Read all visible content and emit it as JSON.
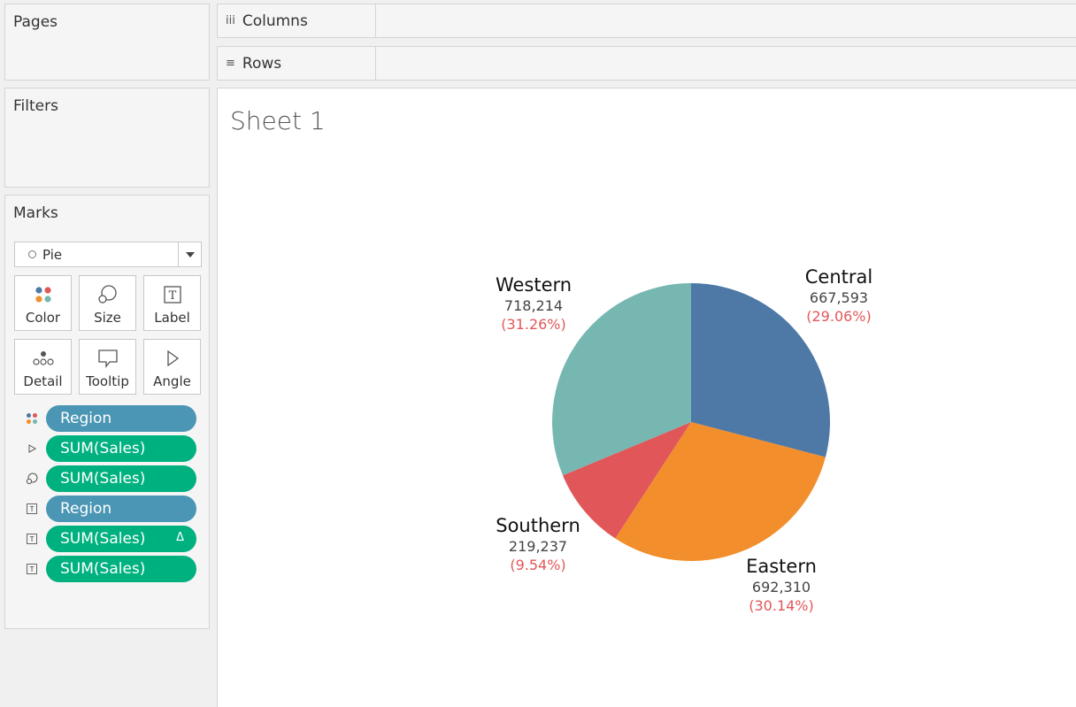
{
  "pages": {
    "title": "Pages"
  },
  "filters": {
    "title": "Filters"
  },
  "shelves": {
    "columns": {
      "icon": "iii",
      "label": "Columns"
    },
    "rows": {
      "icon": "≡",
      "label": "Rows"
    }
  },
  "marks": {
    "title": "Marks",
    "mark_type": "Pie",
    "buttons": [
      {
        "label": "Color",
        "icon": "color-dots-icon"
      },
      {
        "label": "Size",
        "icon": "size-icon"
      },
      {
        "label": "Label",
        "icon": "label-t-icon"
      },
      {
        "label": "Detail",
        "icon": "detail-dots-icon"
      },
      {
        "label": "Tooltip",
        "icon": "tooltip-icon"
      },
      {
        "label": "Angle",
        "icon": "angle-icon"
      }
    ],
    "pills": [
      {
        "label": "Region",
        "kind": "dimension",
        "encoding": "color"
      },
      {
        "label": "SUM(Sales)",
        "kind": "measure",
        "encoding": "angle"
      },
      {
        "label": "SUM(Sales)",
        "kind": "measure",
        "encoding": "size"
      },
      {
        "label": "Region",
        "kind": "dimension",
        "encoding": "label"
      },
      {
        "label": "SUM(Sales)",
        "kind": "measure",
        "encoding": "label",
        "badge": "Δ"
      },
      {
        "label": "SUM(Sales)",
        "kind": "measure",
        "encoding": "label"
      }
    ]
  },
  "sheet": {
    "title": "Sheet 1"
  },
  "chart_data": {
    "type": "pie",
    "slices": [
      {
        "name": "Central",
        "value": 667593,
        "value_label": "667,593",
        "pct_label": "(29.06%)",
        "color": "#4e79a7"
      },
      {
        "name": "Eastern",
        "value": 692310,
        "value_label": "692,310",
        "pct_label": "(30.14%)",
        "color": "#f28e2b"
      },
      {
        "name": "Southern",
        "value": 219237,
        "value_label": "219,237",
        "pct_label": "(9.54%)",
        "color": "#e15759"
      },
      {
        "name": "Western",
        "value": 718214,
        "value_label": "718,214",
        "pct_label": "(31.26%)",
        "color": "#76b7b2"
      }
    ],
    "start_angle": "12 o'clock, clockwise",
    "pct_color": "#e15759"
  }
}
